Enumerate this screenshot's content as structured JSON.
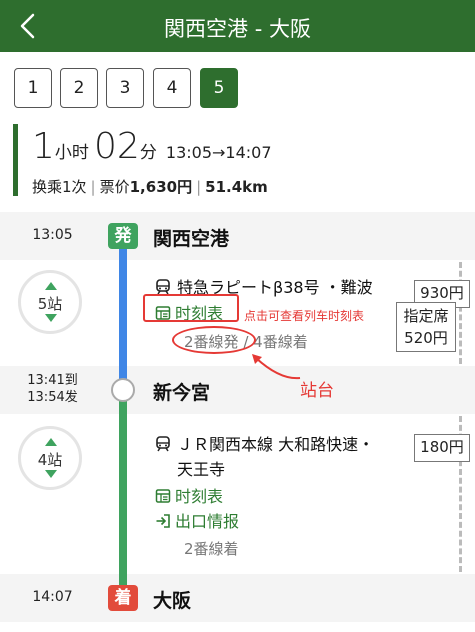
{
  "header": {
    "title": "関西空港 - 大阪"
  },
  "tabs": [
    "1",
    "2",
    "3",
    "4",
    "5"
  ],
  "active_tab": "5",
  "summary": {
    "hours": "1",
    "hours_unit": "小时",
    "minutes": "02",
    "minutes_unit": "分",
    "times": "13:05→14:07",
    "transfers": "换乘1次",
    "fare_label": "票价",
    "fare_value": "1,630円",
    "distance": "51.4km"
  },
  "stations": {
    "origin": {
      "time": "13:05",
      "badge": "発",
      "name": "関西空港"
    },
    "transfer": {
      "time_arrive": "13:41到",
      "time_depart": "13:54发",
      "name": "新今宮"
    },
    "destination": {
      "time": "14:07",
      "badge": "着",
      "name": "大阪"
    }
  },
  "segment1": {
    "stops": "5站",
    "train": "特急ラピートβ38号 ・難波",
    "timetable": "时刻表",
    "platform_depart": "2番線発",
    "platform_sep": "/",
    "platform_arrive": "4番線着",
    "fare": "930円",
    "seat_label": "指定席",
    "seat_fare": "520円"
  },
  "segment2": {
    "stops": "4站",
    "train_line1": "ＪＲ関西本線 大和路快速・",
    "train_line2": "天王寺",
    "timetable": "时刻表",
    "exit_info": "出口情报",
    "platform": "2番線着",
    "fare": "180円"
  },
  "annotations": {
    "timetable_hint": "点击可查看列车时刻表",
    "platform_hint": "站台"
  },
  "colors": {
    "header_green": "#2e6e2e",
    "rail_blue": "#3f86e6",
    "rail_green": "#3fa35f",
    "arrive_red": "#e24b3b",
    "annotation_red": "#e53935"
  }
}
